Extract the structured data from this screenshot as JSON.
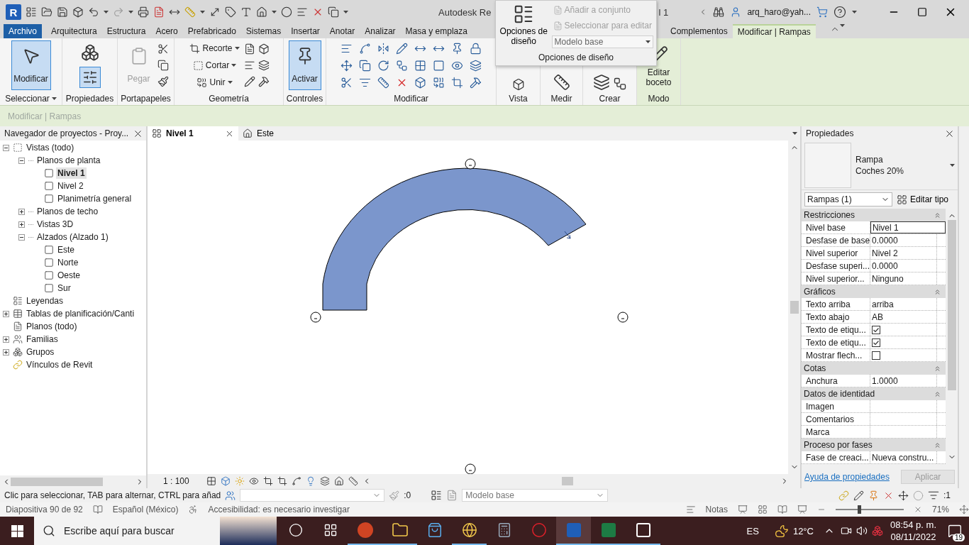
{
  "title_bar": {
    "logo": "R",
    "title": "Autodesk Re",
    "title_tail": "l 1",
    "user": "arq_haro@yah..."
  },
  "tabs_left": [
    {
      "label": "Archivo",
      "kind": "file",
      "selected": false
    },
    {
      "label": "Arquitectura",
      "kind": "tab",
      "selected": false
    },
    {
      "label": "Estructura",
      "kind": "tab",
      "selected": false
    },
    {
      "label": "Acero",
      "kind": "tab",
      "selected": false
    },
    {
      "label": "Prefabricado",
      "kind": "tab",
      "selected": false
    },
    {
      "label": "Sistemas",
      "kind": "tab",
      "selected": false
    },
    {
      "label": "Insertar",
      "kind": "tab",
      "selected": false
    },
    {
      "label": "Anotar",
      "kind": "tab",
      "selected": false
    },
    {
      "label": "Analizar",
      "kind": "tab",
      "selected": false
    },
    {
      "label": "Masa y emplaza",
      "kind": "tab",
      "selected": false
    }
  ],
  "tabs_right": [
    {
      "label": "Complementos",
      "kind": "tab",
      "selected": false
    },
    {
      "label": "Modificar | Rampas",
      "kind": "context",
      "selected": true
    }
  ],
  "design_options": {
    "label": "Opciones de diseño",
    "items": [
      {
        "label": "Añadir a conjunto",
        "disabled": true
      },
      {
        "label": "Seleccionar para editar",
        "disabled": true
      }
    ],
    "value": "Modelo base",
    "footer": "Opciones de diseño"
  },
  "ribbon_panels": [
    {
      "label": "Seleccionar",
      "kind": "select",
      "menu": true,
      "contextual": false,
      "buttons": [
        {
          "label": "Modificar",
          "selected": true,
          "disabled": false
        }
      ]
    },
    {
      "label": "Propiedades",
      "kind": "properties",
      "menu": false,
      "contextual": false
    },
    {
      "label": "Portapapeles",
      "kind": "clipboard",
      "menu": false,
      "contextual": false,
      "buttons": [
        {
          "label": "Pegar",
          "selected": false,
          "disabled": true
        }
      ]
    },
    {
      "label": "Geometría",
      "kind": "geometry",
      "menu": false,
      "contextual": false,
      "buttons": [
        {
          "label": "Recorte",
          "selected": false,
          "disabled": false
        },
        {
          "label": "Cortar",
          "selected": false,
          "disabled": false
        },
        {
          "label": "Unir",
          "selected": false,
          "disabled": false
        }
      ]
    },
    {
      "label": "Controles",
      "kind": "controls",
      "menu": false,
      "contextual": false,
      "buttons": [
        {
          "label": "Activar",
          "selected": true,
          "disabled": false
        }
      ]
    },
    {
      "label": "Modificar",
      "kind": "modify",
      "menu": false,
      "contextual": false
    },
    {
      "label": "Vista",
      "kind": "view",
      "menu": false,
      "contextual": false
    },
    {
      "label": "Medir",
      "kind": "measure",
      "menu": false,
      "contextual": false
    },
    {
      "label": "Crear",
      "kind": "create",
      "menu": false,
      "contextual": false
    },
    {
      "label": "Modo",
      "kind": "mode",
      "menu": false,
      "contextual": true,
      "buttons": [
        {
          "label": "Editar boceto",
          "selected": false,
          "disabled": false
        }
      ]
    }
  ],
  "context_bar": "Modificar | Rampas",
  "project_browser": {
    "title": "Navegador de proyectos - Proy...",
    "tree": [
      {
        "label": "Vistas (todo)",
        "kind": "views",
        "expanded": true,
        "selected": false,
        "children": [
          {
            "label": "Planos de planta",
            "kind": "group",
            "expanded": true,
            "selected": false,
            "children": [
              {
                "label": "Nivel 1",
                "kind": "view",
                "selected": true
              },
              {
                "label": "Nivel 2",
                "kind": "view",
                "selected": false
              },
              {
                "label": "Planimetría general",
                "kind": "view",
                "selected": false
              }
            ]
          },
          {
            "label": "Planos de techo",
            "kind": "group",
            "expanded": false,
            "selected": false
          },
          {
            "label": "Vistas 3D",
            "kind": "group",
            "expanded": false,
            "selected": false
          },
          {
            "label": "Alzados (Alzado 1)",
            "kind": "group",
            "expanded": true,
            "selected": false,
            "children": [
              {
                "label": "Este",
                "kind": "view",
                "selected": false
              },
              {
                "label": "Norte",
                "kind": "view",
                "selected": false
              },
              {
                "label": "Oeste",
                "kind": "view",
                "selected": false
              },
              {
                "label": "Sur",
                "kind": "view",
                "selected": false
              }
            ]
          }
        ]
      },
      {
        "label": "Leyendas",
        "kind": "legends",
        "selected": false
      },
      {
        "label": "Tablas de planificación/Canti",
        "kind": "schedules",
        "expanded": false,
        "selected": false
      },
      {
        "label": "Planos (todo)",
        "kind": "sheets",
        "selected": false
      },
      {
        "label": "Familias",
        "kind": "families",
        "expanded": false,
        "selected": false
      },
      {
        "label": "Grupos",
        "kind": "groups",
        "expanded": false,
        "selected": false
      },
      {
        "label": "Vínculos de Revit",
        "kind": "links",
        "selected": false
      }
    ]
  },
  "view_tabs": [
    {
      "label": "Nivel 1",
      "kind": "plan",
      "selected": true
    },
    {
      "label": "Este",
      "kind": "elevation",
      "selected": false
    }
  ],
  "view": {
    "scale": "1 : 100"
  },
  "properties": {
    "title": "Propiedades",
    "type_name": "Rampa",
    "type_detail": "Coches 20%",
    "selector": "Rampas (1)",
    "edit_type": "Editar tipo",
    "groups": [
      {
        "name": "Restricciones",
        "expanded": true,
        "rows": [
          {
            "label": "Nivel base",
            "value": "Nivel 1",
            "kind": "field"
          },
          {
            "label": "Desfase de base",
            "value": "0.0000",
            "kind": "text"
          },
          {
            "label": "Nivel superior",
            "value": "Nivel 2",
            "kind": "text"
          },
          {
            "label": "Desfase superi...",
            "value": "0.0000",
            "kind": "text"
          },
          {
            "label": "Nivel superior...",
            "value": "Ninguno",
            "kind": "text"
          }
        ]
      },
      {
        "name": "Gráficos",
        "expanded": true,
        "rows": [
          {
            "label": "Texto arriba",
            "value": "arriba",
            "kind": "text"
          },
          {
            "label": "Texto abajo",
            "value": "AB",
            "kind": "text"
          },
          {
            "label": "Texto de etiqu...",
            "kind": "checkbox",
            "checked": true
          },
          {
            "label": "Texto de etiqu...",
            "kind": "checkbox",
            "checked": true
          },
          {
            "label": "Mostrar flech...",
            "kind": "checkbox",
            "checked": false
          }
        ]
      },
      {
        "name": "Cotas",
        "expanded": true,
        "rows": [
          {
            "label": "Anchura",
            "value": "1.0000",
            "kind": "text"
          }
        ]
      },
      {
        "name": "Datos de identidad",
        "expanded": true,
        "rows": [
          {
            "label": "Imagen",
            "kind": "text"
          },
          {
            "label": "Comentarios",
            "kind": "text"
          },
          {
            "label": "Marca",
            "kind": "text"
          }
        ]
      },
      {
        "name": "Proceso por fases",
        "expanded": true,
        "rows": [
          {
            "label": "Fase de creaci...",
            "value": "Nueva constru...",
            "kind": "text"
          }
        ]
      }
    ],
    "help": "Ayuda de propiedades",
    "apply": "Aplicar",
    "apply_disabled": true
  },
  "status_bar": {
    "hint": "Clic para seleccionar, TAB para alternar, CTRL para añad",
    "count": ":0",
    "workset": "Modelo base",
    "filter_count": ":1"
  },
  "ppt_status": {
    "slide": "Diapositiva 90 de 92",
    "language": "Español (México)",
    "accessibility": "Accesibilidad: es necesario investigar",
    "notes": "Notas",
    "zoom": "71%",
    "zoom_slider": {
      "level": 0.34
    }
  },
  "taskbar": {
    "search_placeholder": "Escribe aquí para buscar",
    "apps": [
      {
        "kind": "cortana",
        "open": false,
        "active": false
      },
      {
        "kind": "taskview",
        "open": false,
        "active": false
      },
      {
        "kind": "powerpoint",
        "open": true,
        "active": false
      },
      {
        "kind": "explorer",
        "open": true,
        "active": false
      },
      {
        "kind": "store",
        "open": false,
        "active": false
      },
      {
        "kind": "browser",
        "open": true,
        "active": false
      },
      {
        "kind": "calculator",
        "open": false,
        "active": false
      },
      {
        "kind": "opera",
        "open": false,
        "active": false
      },
      {
        "kind": "revit",
        "open": true,
        "active": true
      },
      {
        "kind": "excel",
        "open": true,
        "active": false
      },
      {
        "kind": "zip",
        "open": true,
        "active": false
      }
    ],
    "language": "ES",
    "temperature": "12°C",
    "time": "08:54 p. m.",
    "date": "08/11/2022",
    "notifications": "19"
  }
}
